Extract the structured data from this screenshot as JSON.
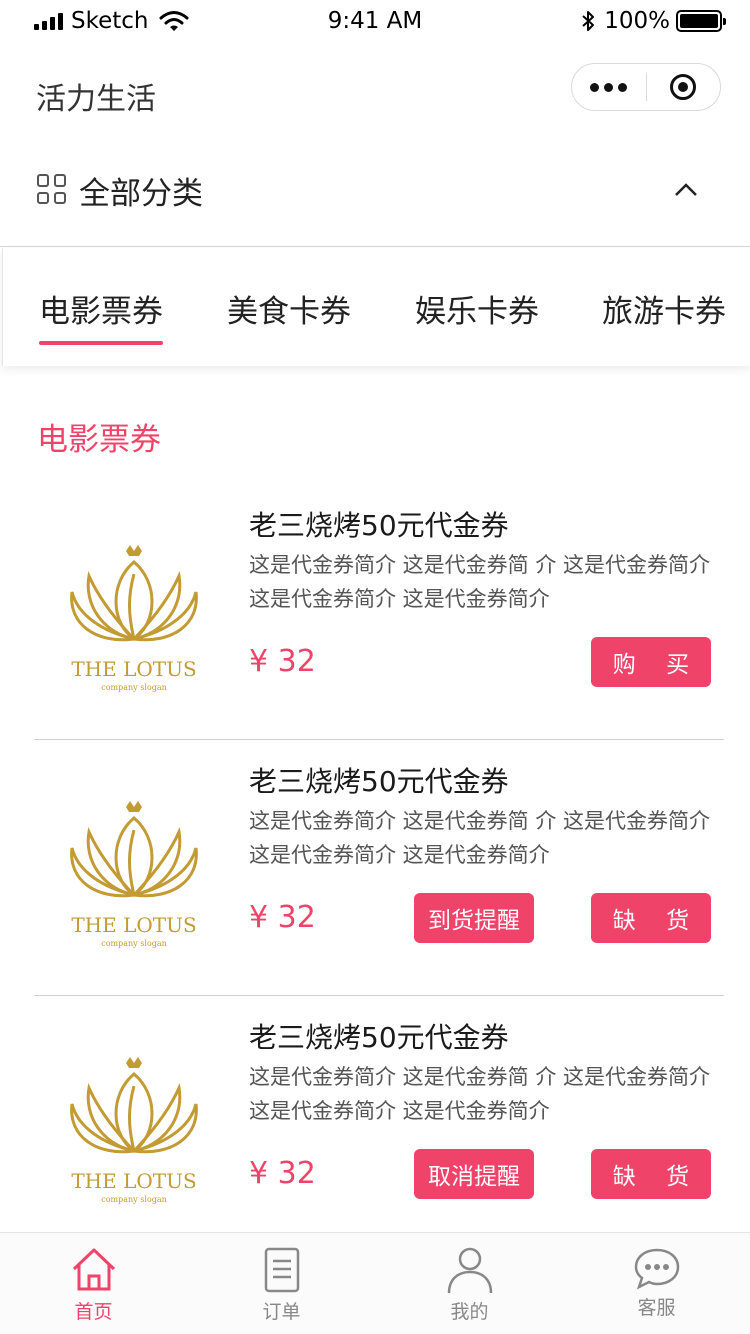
{
  "status_bar": {
    "carrier": "Sketch",
    "time": "9:41 AM",
    "battery": "100%"
  },
  "nav": {
    "title": "活力生活"
  },
  "category": {
    "label": "全部分类"
  },
  "tabs": [
    {
      "label": "电影票券",
      "active": true
    },
    {
      "label": "美食卡券",
      "active": false
    },
    {
      "label": "娱乐卡券",
      "active": false
    },
    {
      "label": "旅游卡券",
      "active": false
    }
  ],
  "section_title": "电影票券",
  "logo": {
    "brand": "THE LOTUS",
    "slogan": "company slogan",
    "color": "#c39a33"
  },
  "items": [
    {
      "title": "老三烧烤50元代金券",
      "desc": "这是代金券简介 这是代金券简 介 这是代金券简介 这是代金券简介 这是代金券简介",
      "price": "¥ 32",
      "buttons": [
        "购 买"
      ]
    },
    {
      "title": "老三烧烤50元代金券",
      "desc": "这是代金券简介 这是代金券简 介 这是代金券简介 这是代金券简介 这是代金券简介",
      "price": "¥ 32",
      "buttons": [
        "到货提醒",
        "缺 货"
      ]
    },
    {
      "title": "老三烧烤50元代金券",
      "desc": "这是代金券简介 这是代金券简 介 这是代金券简介 这是代金券简介 这是代金券简介",
      "price": "¥ 32",
      "buttons": [
        "取消提醒",
        "缺 货"
      ]
    }
  ],
  "tabbar": [
    {
      "label": "首页",
      "icon": "home-icon",
      "active": true
    },
    {
      "label": "订单",
      "icon": "document-icon",
      "active": false
    },
    {
      "label": "我的",
      "icon": "user-icon",
      "active": false
    },
    {
      "label": "客服",
      "icon": "chat-icon",
      "active": false
    }
  ],
  "colors": {
    "accent": "#f0436a",
    "gold": "#c39a33"
  }
}
